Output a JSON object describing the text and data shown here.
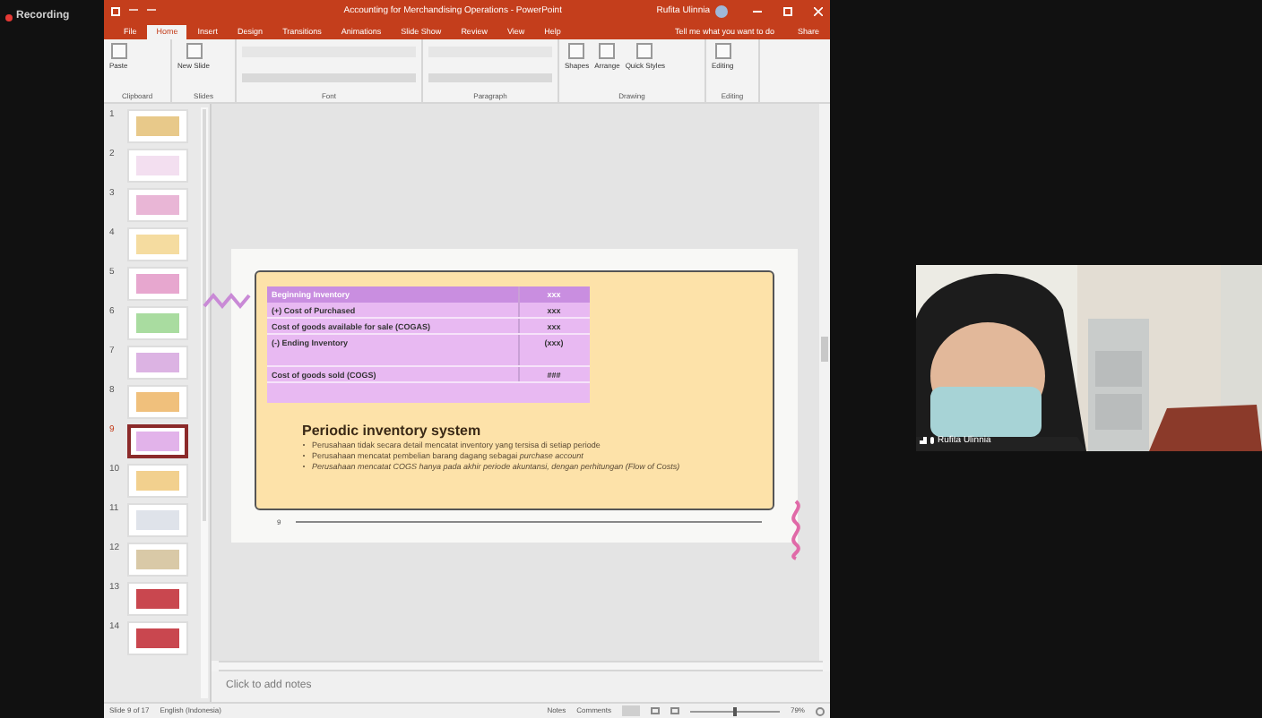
{
  "recording": {
    "label": "Recording"
  },
  "window": {
    "title": "Accounting for Merchandising Operations - PowerPoint",
    "user": "Rufita Ulinnia"
  },
  "ribbon_tabs": [
    {
      "label": "File",
      "selected": false
    },
    {
      "label": "Home",
      "selected": true
    },
    {
      "label": "Insert",
      "selected": false
    },
    {
      "label": "Design",
      "selected": false
    },
    {
      "label": "Transitions",
      "selected": false
    },
    {
      "label": "Animations",
      "selected": false
    },
    {
      "label": "Slide Show",
      "selected": false
    },
    {
      "label": "Review",
      "selected": false
    },
    {
      "label": "View",
      "selected": false
    },
    {
      "label": "Help",
      "selected": false
    }
  ],
  "tell_me": "Tell me what you want to do",
  "share": "Share",
  "ribbon_groups": [
    {
      "name": "Clipboard",
      "buttons": [
        "Paste"
      ]
    },
    {
      "name": "Slides",
      "buttons": [
        "New Slide"
      ]
    },
    {
      "name": "Font"
    },
    {
      "name": "Paragraph"
    },
    {
      "name": "Drawing",
      "buttons": [
        "Shapes",
        "Arrange",
        "Quick Styles"
      ]
    },
    {
      "name": "Editing",
      "buttons": [
        "Editing"
      ]
    }
  ],
  "thumbnails": [
    {
      "number": "1",
      "selected": false,
      "color": "#e8c98a"
    },
    {
      "number": "2",
      "selected": false,
      "color": "#f3dff0"
    },
    {
      "number": "3",
      "selected": false,
      "color": "#e9b6d6"
    },
    {
      "number": "4",
      "selected": false,
      "color": "#f5dca0"
    },
    {
      "number": "5",
      "selected": false,
      "color": "#e7a7cf"
    },
    {
      "number": "6",
      "selected": false,
      "color": "#a9dca0"
    },
    {
      "number": "7",
      "selected": false,
      "color": "#dcb3e3"
    },
    {
      "number": "8",
      "selected": false,
      "color": "#f0c07c"
    },
    {
      "number": "9",
      "selected": true,
      "color": "#e2b3ea"
    },
    {
      "number": "10",
      "selected": false,
      "color": "#f2d08e"
    },
    {
      "number": "11",
      "selected": false,
      "color": "#dfe3ea"
    },
    {
      "number": "12",
      "selected": false,
      "color": "#d9c9a7"
    },
    {
      "number": "13",
      "selected": false,
      "color": "#c9474f"
    },
    {
      "number": "14",
      "selected": false,
      "color": "#c9474f"
    }
  ],
  "slide": {
    "table": [
      {
        "kind": "header",
        "label": "Beginning Inventory",
        "value": "xxx"
      },
      {
        "kind": "row",
        "label": "(+) Cost of Purchased",
        "value": "xxx"
      },
      {
        "kind": "row",
        "label": "Cost of goods available for sale (COGAS)",
        "value": "xxx"
      },
      {
        "kind": "tall",
        "label": "(-) Ending Inventory",
        "value": "(xxx)"
      },
      {
        "kind": "row",
        "label": "Cost of goods sold (COGS)",
        "value": "###"
      },
      {
        "kind": "blank"
      }
    ],
    "title": "Periodic inventory system",
    "bullets": [
      "Perusahaan tidak secara detail mencatat inventory yang tersisa di setiap periode",
      "Perusahaan mencatat pembelian barang dagang sebagai *purchase account*",
      "*Perusahaan mencatat COGS hanya pada akhir periode akuntansi, dengan perhitungan (Flow of Costs)*"
    ],
    "number": "9"
  },
  "notes": {
    "placeholder": "Click to add notes"
  },
  "status_bar": {
    "slide": "Slide 9 of 17",
    "language": "English (Indonesia)",
    "notes": "Notes",
    "comments": "Comments",
    "zoom": "79%",
    "level": 0.5
  },
  "participant": {
    "name": "Rufita Ulinnia"
  }
}
